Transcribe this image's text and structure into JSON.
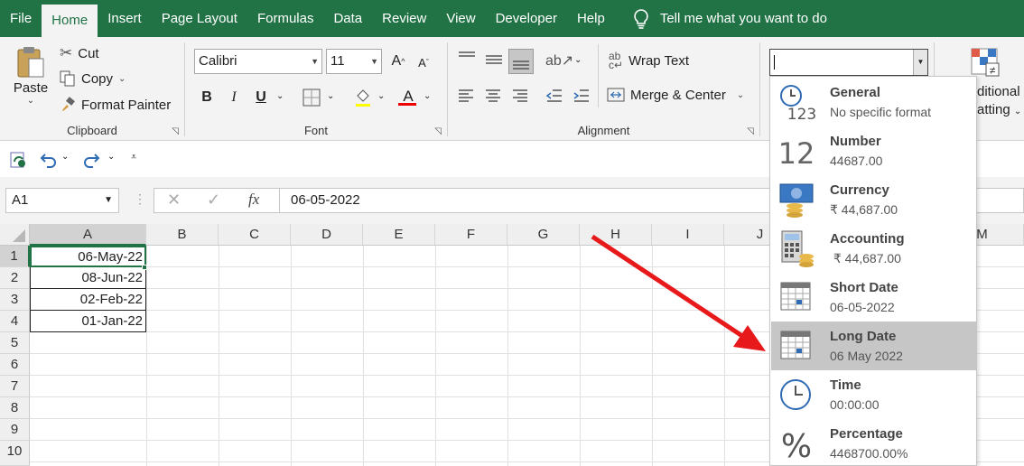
{
  "menu": {
    "tabs": [
      "File",
      "Home",
      "Insert",
      "Page Layout",
      "Formulas",
      "Data",
      "Review",
      "View",
      "Developer",
      "Help"
    ],
    "active": "Home",
    "tellme": "Tell me what you want to do"
  },
  "ribbon": {
    "clipboard": {
      "paste": "Paste",
      "cut": "Cut",
      "copy": "Copy",
      "format_painter": "Format Painter",
      "label": "Clipboard"
    },
    "font": {
      "name": "Calibri",
      "size": "11",
      "bold": "B",
      "italic": "I",
      "underline": "U",
      "label": "Font",
      "grow": "A",
      "shrink": "A",
      "color_letter": "A"
    },
    "alignment": {
      "wrap_text": "Wrap Text",
      "merge_center": "Merge & Center",
      "label": "Alignment"
    },
    "number": {
      "format_value": ""
    },
    "styles": {
      "conditional_line1": "ditional",
      "conditional_line2": "atting"
    }
  },
  "formula_bar": {
    "name_box": "A1",
    "value": "06-05-2022",
    "fx": "fx"
  },
  "grid": {
    "columns": [
      "A",
      "B",
      "C",
      "D",
      "E",
      "F",
      "G",
      "H",
      "I",
      "J",
      "M"
    ],
    "rows": [
      "1",
      "2",
      "3",
      "4",
      "5",
      "6",
      "7",
      "8",
      "9",
      "10"
    ],
    "a_values": [
      "06-May-22",
      "08-Jun-22",
      "02-Feb-22",
      "01-Jan-22"
    ]
  },
  "number_formats": [
    {
      "name": "General",
      "example": "No specific format",
      "icon": "clock-123-icon"
    },
    {
      "name": "Number",
      "example": "44687.00",
      "icon": "number-12-icon"
    },
    {
      "name": "Currency",
      "example": "₹ 44,687.00",
      "icon": "currency-money-icon"
    },
    {
      "name": "Accounting",
      "example": " ₹ 44,687.00",
      "icon": "calculator-coins-icon"
    },
    {
      "name": "Short Date",
      "example": "06-05-2022",
      "icon": "calendar-icon"
    },
    {
      "name": "Long Date",
      "example": "06 May 2022",
      "icon": "calendar-icon"
    },
    {
      "name": "Time",
      "example": "00:00:00",
      "icon": "clock-icon"
    },
    {
      "name": "Percentage",
      "example": "4468700.00%",
      "icon": "percent-icon"
    }
  ],
  "highlighted_format": "Long Date",
  "colors": {
    "excel_green": "#217346",
    "arrow_red": "#e8191b",
    "highlight": "#c6c6c6"
  }
}
